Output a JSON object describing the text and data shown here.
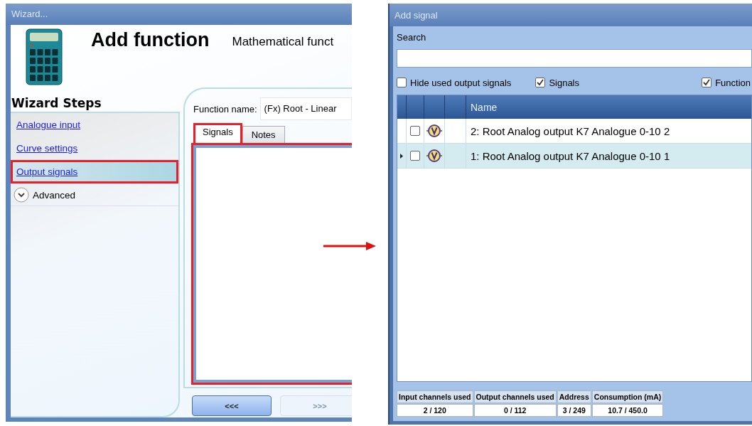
{
  "wizard": {
    "title": "Wizard...",
    "heading": "Add function",
    "subtitle": "Mathematical funct",
    "steps_title": "Wizard Steps",
    "steps": [
      {
        "label": "Analogue input",
        "selected": false,
        "highlighted": false
      },
      {
        "label": "Curve settings",
        "selected": false,
        "highlighted": false
      },
      {
        "label": "Output signals",
        "selected": true,
        "highlighted": true
      }
    ],
    "advanced": {
      "label": "Advanced",
      "expanded": false
    },
    "function_name": {
      "label": "Function name:",
      "value": "(Fx) Root - Linear"
    },
    "tabs": [
      {
        "label": "Signals",
        "selected": true,
        "highlighted": true
      },
      {
        "label": "Notes",
        "selected": false,
        "highlighted": false
      }
    ],
    "tab_panel_highlighted": true,
    "buttons": [
      {
        "label": "<<<",
        "disabled": false
      },
      {
        "label": ">>>",
        "disabled": true
      }
    ]
  },
  "add_signal": {
    "title": "Add signal",
    "search": {
      "label": "Search"
    },
    "filters": [
      {
        "label": "Hide used output signals",
        "checked": false
      },
      {
        "label": "Signals",
        "checked": true
      },
      {
        "label": "Function",
        "checked": true
      }
    ],
    "table": {
      "columns": [
        "Name"
      ],
      "rows": [
        {
          "name": "2: Root Analog output K7 Analogue 0-10 2",
          "checked": false,
          "selected": false
        },
        {
          "name": "1: Root Analog output K7 Analogue 0-10 1",
          "checked": false,
          "selected": true
        }
      ]
    },
    "stats": [
      {
        "label": "Input channels used",
        "value": "2 / 120"
      },
      {
        "label": "Output channels used",
        "value": "0 / 112"
      },
      {
        "label": "Address",
        "value": "3 / 249"
      },
      {
        "label": "Consumption (mA)",
        "value": "10.7 / 450.0"
      }
    ]
  }
}
